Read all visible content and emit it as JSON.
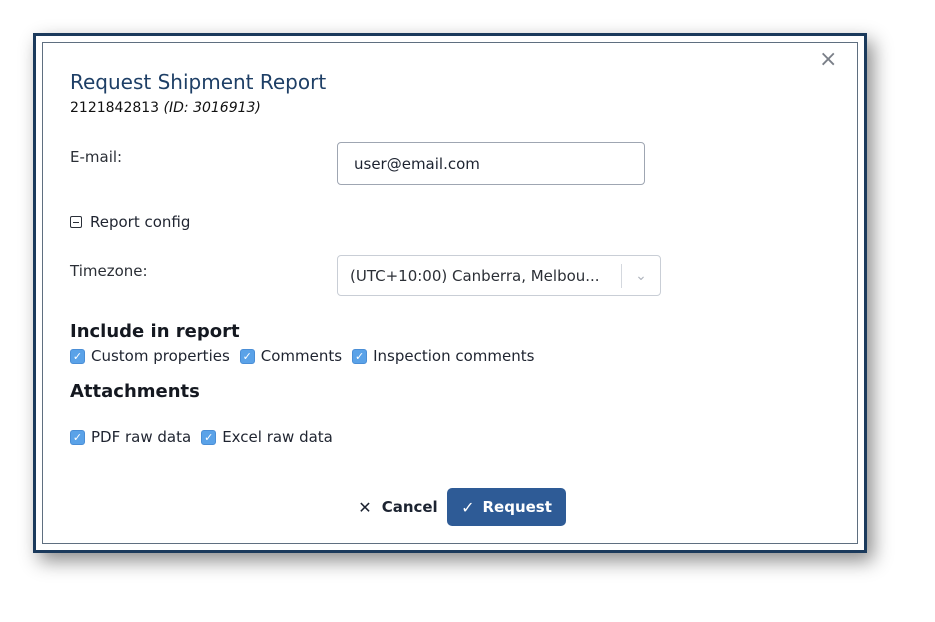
{
  "dialog": {
    "title": "Request Shipment Report",
    "shipment_number": "2121842813",
    "shipment_id": "(ID: 3016913)",
    "close_icon": "close-icon"
  },
  "form": {
    "email_label": "E-mail:",
    "email_value": "user@email.com",
    "report_config_label": "Report config",
    "timezone_label": "Timezone:",
    "timezone_value": "(UTC+10:00) Canberra, Melbou..."
  },
  "include": {
    "heading": "Include in report",
    "items": [
      {
        "label": "Custom properties",
        "checked": true
      },
      {
        "label": "Comments",
        "checked": true
      },
      {
        "label": "Inspection comments",
        "checked": true
      }
    ]
  },
  "attachments": {
    "heading": "Attachments",
    "items": [
      {
        "label": "PDF raw data",
        "checked": true
      },
      {
        "label": "Excel raw data",
        "checked": true
      }
    ]
  },
  "actions": {
    "cancel_label": "Cancel",
    "request_label": "Request"
  },
  "colors": {
    "primary": "#2e5b96",
    "title": "#1e3f66",
    "checkbox": "#5aa2e8",
    "frame_border": "#1b3a5c"
  }
}
